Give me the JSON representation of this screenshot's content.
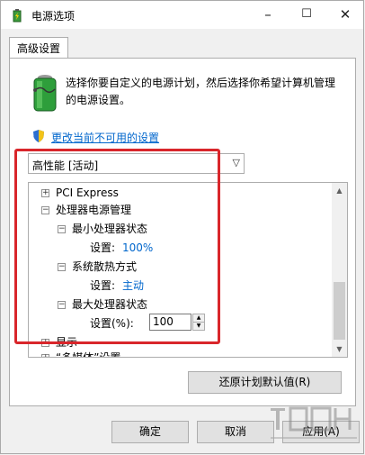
{
  "window": {
    "title": "电源选项",
    "minimize": "–",
    "maximize": "☐",
    "close": "✕"
  },
  "tab": "高级设置",
  "description": "选择你要自定义的电源计划，然后选择你希望计算机管理的电源设置。",
  "change_link": "更改当前不可用的设置",
  "plan_select": {
    "value": "高性能 [活动]"
  },
  "tree": {
    "pci": "PCI Express",
    "processor": "处理器电源管理",
    "min_state": "最小处理器状态",
    "min_label": "设置:",
    "min_value": "100%",
    "cooling": "系统散热方式",
    "cooling_label": "设置:",
    "cooling_value": "主动",
    "max_state": "最大处理器状态",
    "max_label": "设置(%):",
    "max_value": "100",
    "display": "显示",
    "multimedia": "“多媒体”设置"
  },
  "restore_button": "还原计划默认值(R)",
  "ok_button": "确定",
  "cancel_button": "取消",
  "apply_button": "应用(A)",
  "colors": {
    "link": "#0066cc",
    "highlight": "#d9262b"
  }
}
